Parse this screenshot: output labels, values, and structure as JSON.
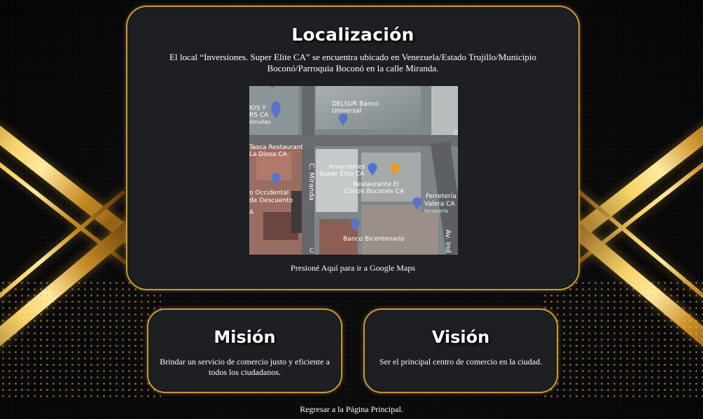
{
  "localizacion": {
    "title": "Localización",
    "description": "El local “Inversiones. Super Elite CA” se encuentra ubicado en Venezuela/Estado Trujillo/Municipio Boconó/Parroquia Boconó en la calle Miranda.",
    "maps_link": "Presioné Aquí para ir a Google Maps"
  },
  "map": {
    "labels": {
      "delsur": "DELSUR Banco",
      "delsur2": "Universal",
      "tasca": "Tasca Restaurant",
      "tasca2": "La Diosa CA",
      "calle_miranda": "C. Miranda",
      "inversiones": "Inversiones",
      "inversiones2": "Super Elite CA",
      "restaurante": "Restaurante El",
      "restaurante2": "Conde Boconés CA",
      "ferreteria": "Ferretería",
      "ferreteria2": "Valera CA",
      "ferreteria3": "Ferretería",
      "occidental": "o Occidental",
      "occidental2": "de Descuento",
      "occidental3": "A",
      "banco_bicentenario": "Banco Bicentenario",
      "av": "Av. Ind",
      "top_left": "IOS Y",
      "top_left2": "RS CA",
      "top_left3": "ómviles",
      "g": "G",
      "c": "C"
    }
  },
  "mision": {
    "title": "Misión",
    "text": "Brindar un servicio de comercio justo y eficiente a todos los ciudadanos."
  },
  "vision": {
    "title": "Visión",
    "text": "Ser el principal centro de comercio en la ciudad."
  },
  "footer": {
    "back_link": "Regresar a la Página Principal."
  },
  "colors": {
    "panel_bg": "#1d1f22",
    "panel_border": "#c99a3a",
    "gold": "#f6d36a"
  }
}
